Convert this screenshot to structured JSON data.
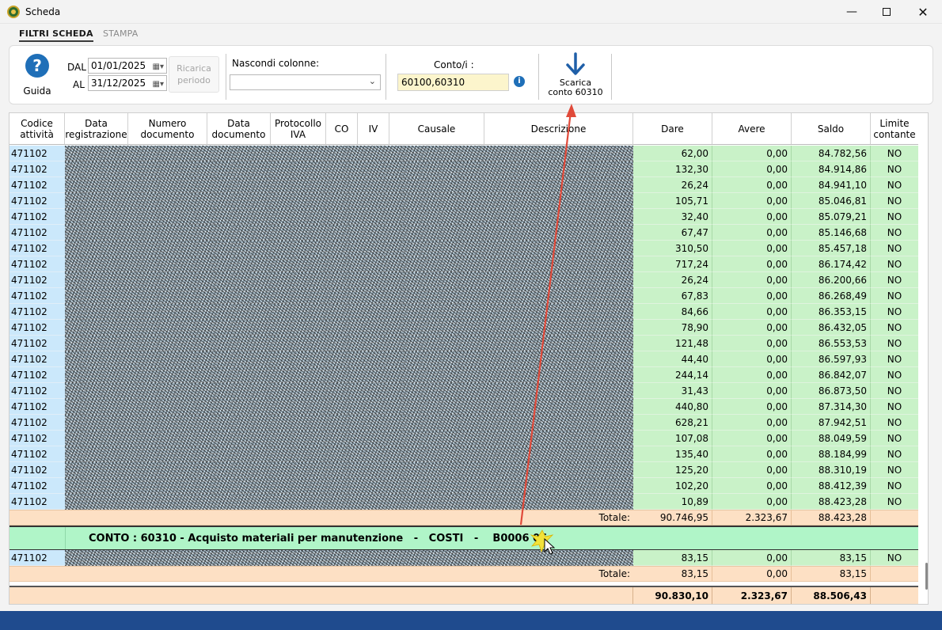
{
  "window": {
    "title": "Scheda"
  },
  "tabs": [
    {
      "label": "FILTRI SCHEDA",
      "active": true
    },
    {
      "label": "STAMPA",
      "active": false
    }
  ],
  "toolbar": {
    "guida_label": "Guida",
    "dal_label": "DAL",
    "dal_value": "01/01/2025",
    "al_label": "AL",
    "al_value": "31/12/2025",
    "ricarica_line1": "Ricarica",
    "ricarica_line2": "periodo",
    "nascondi_label": "Nascondi colonne:",
    "nascondi_value": "",
    "conto_label": "Conto/i :",
    "conto_value": "60100,60310",
    "scarica_line1": "Scarica",
    "scarica_line2": "conto 60310"
  },
  "columns": {
    "codice_1": "Codice",
    "codice_2": "attività",
    "datareg_1": "Data",
    "datareg_2": "registrazione",
    "numdoc_1": "Numero",
    "numdoc_2": "documento",
    "datadoc_1": "Data",
    "datadoc_2": "documento",
    "protiva_1": "Protocollo",
    "protiva_2": "IVA",
    "co": "CO",
    "iv": "IV",
    "causale": "Causale",
    "descrizione": "Descrizione",
    "dare": "Dare",
    "avere": "Avere",
    "saldo": "Saldo",
    "limite_1": "Limite",
    "limite_2": "contante"
  },
  "rows": [
    {
      "code": "471102",
      "dare": "62,00",
      "avere": "0,00",
      "saldo": "84.782,56",
      "limite": "NO"
    },
    {
      "code": "471102",
      "dare": "132,30",
      "avere": "0,00",
      "saldo": "84.914,86",
      "limite": "NO"
    },
    {
      "code": "471102",
      "dare": "26,24",
      "avere": "0,00",
      "saldo": "84.941,10",
      "limite": "NO"
    },
    {
      "code": "471102",
      "dare": "105,71",
      "avere": "0,00",
      "saldo": "85.046,81",
      "limite": "NO"
    },
    {
      "code": "471102",
      "dare": "32,40",
      "avere": "0,00",
      "saldo": "85.079,21",
      "limite": "NO"
    },
    {
      "code": "471102",
      "dare": "67,47",
      "avere": "0,00",
      "saldo": "85.146,68",
      "limite": "NO"
    },
    {
      "code": "471102",
      "dare": "310,50",
      "avere": "0,00",
      "saldo": "85.457,18",
      "limite": "NO"
    },
    {
      "code": "471102",
      "dare": "717,24",
      "avere": "0,00",
      "saldo": "86.174,42",
      "limite": "NO"
    },
    {
      "code": "471102",
      "dare": "26,24",
      "avere": "0,00",
      "saldo": "86.200,66",
      "limite": "NO"
    },
    {
      "code": "471102",
      "dare": "67,83",
      "avere": "0,00",
      "saldo": "86.268,49",
      "limite": "NO"
    },
    {
      "code": "471102",
      "dare": "84,66",
      "avere": "0,00",
      "saldo": "86.353,15",
      "limite": "NO"
    },
    {
      "code": "471102",
      "dare": "78,90",
      "avere": "0,00",
      "saldo": "86.432,05",
      "limite": "NO"
    },
    {
      "code": "471102",
      "dare": "121,48",
      "avere": "0,00",
      "saldo": "86.553,53",
      "limite": "NO"
    },
    {
      "code": "471102",
      "dare": "44,40",
      "avere": "0,00",
      "saldo": "86.597,93",
      "limite": "NO"
    },
    {
      "code": "471102",
      "dare": "244,14",
      "avere": "0,00",
      "saldo": "86.842,07",
      "limite": "NO"
    },
    {
      "code": "471102",
      "dare": "31,43",
      "avere": "0,00",
      "saldo": "86.873,50",
      "limite": "NO"
    },
    {
      "code": "471102",
      "dare": "440,80",
      "avere": "0,00",
      "saldo": "87.314,30",
      "limite": "NO"
    },
    {
      "code": "471102",
      "dare": "628,21",
      "avere": "0,00",
      "saldo": "87.942,51",
      "limite": "NO"
    },
    {
      "code": "471102",
      "dare": "107,08",
      "avere": "0,00",
      "saldo": "88.049,59",
      "limite": "NO"
    },
    {
      "code": "471102",
      "dare": "135,40",
      "avere": "0,00",
      "saldo": "88.184,99",
      "limite": "NO"
    },
    {
      "code": "471102",
      "dare": "125,20",
      "avere": "0,00",
      "saldo": "88.310,19",
      "limite": "NO"
    },
    {
      "code": "471102",
      "dare": "102,20",
      "avere": "0,00",
      "saldo": "88.412,39",
      "limite": "NO"
    },
    {
      "code": "471102",
      "dare": "10,89",
      "avere": "0,00",
      "saldo": "88.423,28",
      "limite": "NO"
    }
  ],
  "totals_1": {
    "label": "Totale:",
    "dare": "90.746,95",
    "avere": "2.323,67",
    "saldo": "88.423,28"
  },
  "account_header": "CONTO : 60310 - Acquisto materiali per manutenzione   -   COSTI   -    B0006 06",
  "rows_2": [
    {
      "code": "471102",
      "dare": "83,15",
      "avere": "0,00",
      "saldo": "83,15",
      "limite": "NO"
    }
  ],
  "totals_2": {
    "label": "Totale:",
    "dare": "83,15",
    "avere": "0,00",
    "saldo": "83,15"
  },
  "grand_total": {
    "dare": "90.830,10",
    "avere": "2.323,67",
    "saldo": "88.506,43"
  },
  "colors": {
    "code_bg": "#cbe8fb",
    "amount_bg": "#c9f2c8",
    "total_bg": "#fde0c4",
    "account_band": "#b0f5c8",
    "annotation": "#e04a3a",
    "status_bar": "#1f4b8e"
  }
}
